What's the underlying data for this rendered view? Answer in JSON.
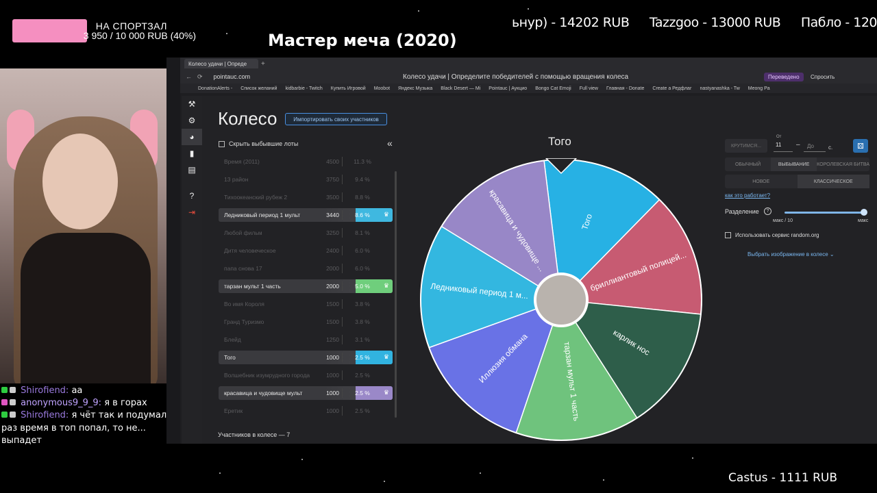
{
  "overlay": {
    "goal_title": "НА СПОРТЗАЛ",
    "goal_amount": "3 950 / 10 000 RUB (40%)",
    "goal_fraction": 0.4,
    "movie_title": "Мастер меча (2020)",
    "ticker": [
      "ьнур) - 14202 RUB",
      "Tazzgoo - 13000 RUB",
      "Пабло - 120"
    ],
    "donation_bottom": "Castus - 1111 RUB"
  },
  "chat": [
    {
      "user": "Shirofiend:",
      "text": "aa"
    },
    {
      "user": "anonymous9_9_9:",
      "text": "я в горах"
    },
    {
      "user": "Shirofiend:",
      "text": "я чёт так и подумал, раз время в топ попал, то не... выпадет"
    }
  ],
  "browser": {
    "tab_title": "Колесо удачи | Опреде",
    "url": "pointauc.com",
    "page_title": "Колесо удачи | Определите победителей с помощью вращения колеса",
    "translated": "Переведено",
    "ask": "Спросить",
    "bookmarks": [
      "DonationAlerts -",
      "Список желаний",
      "kidbarbie - Twitch",
      "Купить Игровой",
      "Moobot",
      "Яндекс Музыка",
      "Black Desert — Mi",
      "Pointauc | Аукцио",
      "Bongo Cat Emoji",
      "Full view",
      "Главная - Donate",
      "Create a Редфлаг",
      "nastyanashka - Tw",
      "Meong Pa"
    ]
  },
  "page": {
    "heading": "Колесо",
    "import_button": "Импортировать своих участников",
    "hide_removed": "Скрыть выбывшие лоты",
    "count_text": "Участников в колесе — 7",
    "winner": "Того"
  },
  "lots": [
    {
      "name": "Время (2011)",
      "amount": "4500",
      "pct": "11.3 %",
      "removed": true
    },
    {
      "name": "13 район",
      "amount": "3750",
      "pct": "9.4 %",
      "removed": true
    },
    {
      "name": "Тихоокеанский рубеж 2",
      "amount": "3500",
      "pct": "8.8 %",
      "removed": true
    },
    {
      "name": "Ледниковый период 1 мульт",
      "amount": "3440",
      "pct": "8.6 %",
      "removed": false,
      "color": "#3fb8e0"
    },
    {
      "name": "Любой фильм",
      "amount": "3250",
      "pct": "8.1 %",
      "removed": true
    },
    {
      "name": "Дитя человеческое",
      "amount": "2400",
      "pct": "6.0 %",
      "removed": true
    },
    {
      "name": "папа снова 17",
      "amount": "2000",
      "pct": "6.0 %",
      "removed": true
    },
    {
      "name": "тарзан мульт 1 часть",
      "amount": "2000",
      "pct": "5.0 %",
      "removed": false,
      "color": "#6fce7c"
    },
    {
      "name": "Во имя Короля",
      "amount": "1500",
      "pct": "3.8 %",
      "removed": true
    },
    {
      "name": "Гранд Туризмо",
      "amount": "1500",
      "pct": "3.8 %",
      "removed": true
    },
    {
      "name": "Блейд",
      "amount": "1250",
      "pct": "3.1 %",
      "removed": true
    },
    {
      "name": "Того",
      "amount": "1000",
      "pct": "2.5 %",
      "removed": false,
      "color": "#31b3e0"
    },
    {
      "name": "Волшебник изумрудного города",
      "amount": "1000",
      "pct": "2.5 %",
      "removed": true
    },
    {
      "name": "красавица и чудовище мульт",
      "amount": "1000",
      "pct": "2.5 %",
      "removed": false,
      "color": "#9a88c8"
    },
    {
      "name": "Еретик",
      "amount": "1000",
      "pct": "2.5 %",
      "removed": true
    }
  ],
  "wheel": {
    "segments": [
      {
        "label": "Того",
        "color": "#27b1e4"
      },
      {
        "label": "бриллиантовый полицей...",
        "color": "#c75b72"
      },
      {
        "label": "карлик нос",
        "color": "#2e5e4a"
      },
      {
        "label": "тарзан мульт 1 часть",
        "color": "#6fc37d"
      },
      {
        "label": "Иллюзия обмана",
        "color": "#6972e6"
      },
      {
        "label": "Ледниковый период 1 м...",
        "color": "#33b7e0"
      },
      {
        "label": "красавица и чудовище ...",
        "color": "#9887c7"
      }
    ]
  },
  "controls": {
    "spin": "КРУТИМСЯ...",
    "from_label": "От",
    "from_value": "11",
    "to_placeholder": "До",
    "seconds": "с.",
    "modes": [
      "ОБЫЧНЫЙ",
      "ВЫБЫВАНИЕ",
      "КОРОЛЕВСКАЯ БИТВА"
    ],
    "modes2": [
      "НОВОЕ",
      "КЛАССИЧЕСКОЕ"
    ],
    "how_link": "как это работает?",
    "split_label": "Разделение",
    "slider_min": "макс / 10",
    "slider_max": "макс",
    "random_org": "Использовать сервис random.org",
    "choose_image": "Выбрать изображение в колесе"
  }
}
